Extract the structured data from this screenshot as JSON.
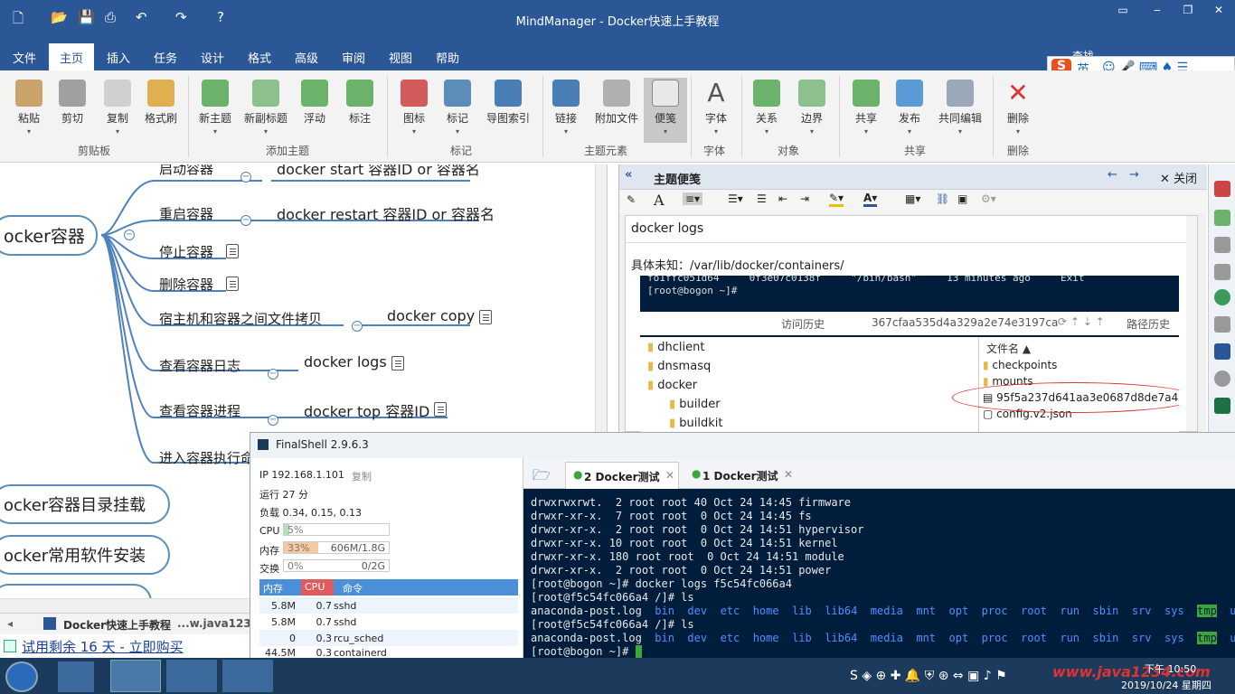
{
  "app": {
    "title": "MindManager - Docker快速上手教程",
    "search_label": "查找"
  },
  "menu_tabs": [
    "文件",
    "主页",
    "插入",
    "任务",
    "设计",
    "格式",
    "高级",
    "审阅",
    "视图",
    "帮助"
  ],
  "ribbon": {
    "buttons": [
      "粘贴",
      "剪切",
      "复制",
      "格式刷",
      "新主题",
      "新副标题",
      "浮动",
      "标注",
      "图标",
      "标记",
      "导图索引",
      "链接",
      "附加文件",
      "便笺",
      "字体",
      "关系",
      "边界",
      "共享",
      "发布",
      "共同编辑",
      "删除"
    ],
    "groups": [
      "剪贴板",
      "添加主题",
      "标记",
      "主题元素",
      "字体",
      "对象",
      "共享",
      "删除"
    ]
  },
  "sogou": {
    "label": "英"
  },
  "map": {
    "root": "ocker容器",
    "topics": [
      {
        "label": "启动容器",
        "child": "docker start 容器ID or 容器名"
      },
      {
        "label": "重启容器",
        "child": "docker restart 容器ID or 容器名"
      },
      {
        "label": "停止容器",
        "child": ""
      },
      {
        "label": "删除容器",
        "child": ""
      },
      {
        "label": "宿主机和容器之间文件拷贝",
        "child": "docker copy"
      },
      {
        "label": "查看容器日志",
        "child": "docker logs"
      },
      {
        "label": "查看容器进程",
        "child": "docker top 容器ID"
      },
      {
        "label": "进入容器执行命",
        "child": ""
      }
    ],
    "siblings": [
      "ocker容器目录挂载",
      "ocker常用软件安装"
    ]
  },
  "doc_tabs": {
    "active": "Docker快速上手教程",
    "other": "...w.java1234..."
  },
  "trial": "试用剩余 16 天 - 立即购买",
  "notes": {
    "header": "主题便笺",
    "close": "关闭",
    "title": "docker logs",
    "line1": "具体未知：/var/lib/docker/containers/",
    "screenshot": {
      "top_line": "fo1ffc051d64     0f3e07c0138f     \"/bin/bash\"     13 minutes ago     Exit",
      "prompt": "[root@bogon ~]# ",
      "history": "访问历史",
      "path": "367cfaa535d4a329a2e74e3197ca",
      "history_path": "路径历史",
      "tree": [
        "dhclient",
        "dnsmasq",
        "docker",
        "builder",
        "buildkit"
      ],
      "files_header": "文件名",
      "files": [
        "checkpoints",
        "mounts",
        "95f5a237d641aa3e0687d8de7a4a",
        "config.v2.json"
      ]
    }
  },
  "finalshell": {
    "title": "FinalShell 2.9.6.3",
    "ip": "IP 192.168.1.101",
    "copy": "复制",
    "uptime": "运行 27 分",
    "load": "负载 0.34, 0.15, 0.13",
    "cpu_label": "CPU",
    "cpu_value": "5%",
    "cpu_pct": 5,
    "mem_label": "内存",
    "mem_value": "33%",
    "mem_pct": 33,
    "mem_detail": "606M/1.8G",
    "swap_label": "交换",
    "swap_value": "0%",
    "swap_detail": "0/2G",
    "proc_headers": [
      "内存",
      "CPU",
      "命令"
    ],
    "processes": [
      {
        "mem": "5.8M",
        "cpu": "0.7",
        "cmd": "sshd"
      },
      {
        "mem": "5.8M",
        "cpu": "0.7",
        "cmd": "sshd"
      },
      {
        "mem": "0",
        "cpu": "0.3",
        "cmd": "rcu_sched"
      },
      {
        "mem": "44.5M",
        "cpu": "0.3",
        "cmd": "containerd"
      }
    ],
    "tabs": [
      {
        "label": "2 Docker测试",
        "active": true
      },
      {
        "label": "1 Docker测试",
        "active": false
      }
    ],
    "terminal": [
      "drwxrwxrwt.  2 root root 40 Oct 24 14:45 firmware",
      "drwxr-xr-x.  7 root root  0 Oct 24 14:45 fs",
      "drwxr-xr-x.  2 root root  0 Oct 24 14:51 hypervisor",
      "drwxr-xr-x. 10 root root  0 Oct 24 14:51 kernel",
      "drwxr-xr-x. 180 root root  0 Oct 24 14:51 module",
      "drwxr-xr-x.  2 root root  0 Oct 24 14:51 power",
      "[root@bogon ~]# docker logs f5c54fc066a4",
      "[root@f5c54fc066a4 /]# ls"
    ],
    "ls_first": "anaconda-post.log",
    "ls_items": [
      "bin",
      "dev",
      "etc",
      "home",
      "lib",
      "lib64",
      "media",
      "mnt",
      "opt",
      "proc",
      "root",
      "run",
      "sbin",
      "srv",
      "sys",
      "tmp",
      "usr"
    ],
    "prompt2": "[root@f5c54fc066a4 /]# ls",
    "prompt_final": "[root@bogon ~]# "
  },
  "taskbar": {
    "time": "下午 10:50",
    "date": "2019/10/24 星期四",
    "watermark": "www.java1234.com"
  },
  "colors": {
    "titlebar": "#2b5797",
    "terminal_bg": "#001e3c",
    "topic_line": "#4f81bd"
  }
}
